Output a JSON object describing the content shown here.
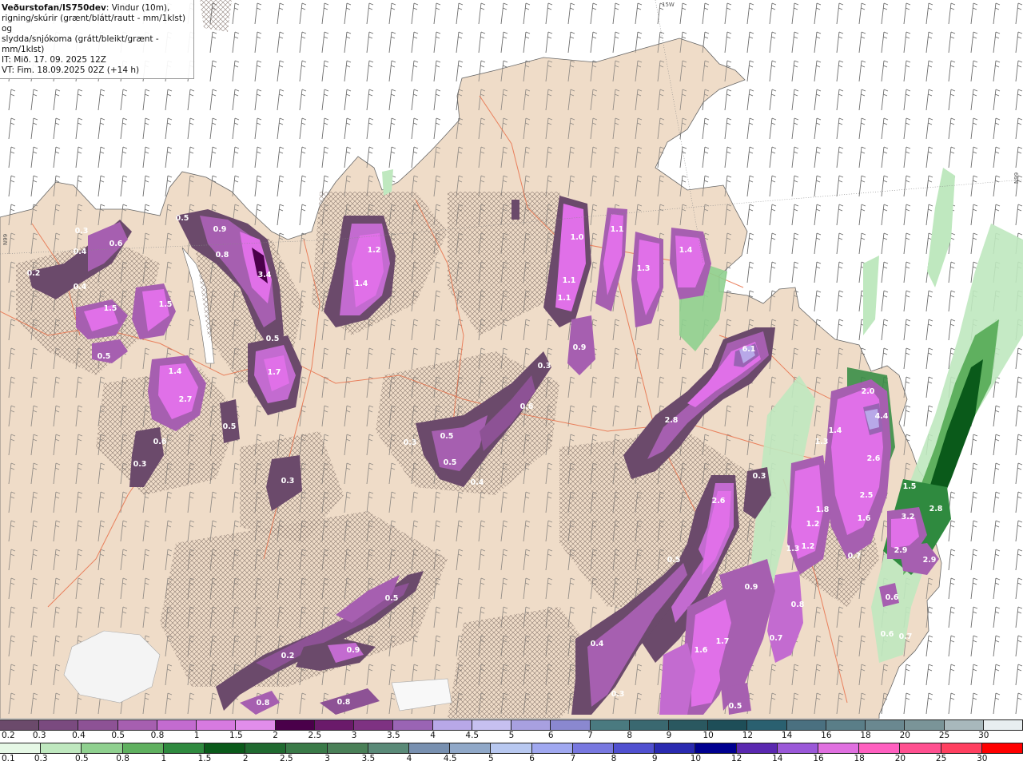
{
  "header": {
    "brand": "Veðurstofan/IS750dev",
    "line1_rest": ": Vindur (10m),",
    "line2": "rigning/skúrir (grænt/blátt/rautt - mm/1klst) og",
    "line3": "slydda/snjókoma (grátt/bleikt/grænt - mm/1klst)",
    "line4": "IT: Mið. 17. 09. 2025 12Z",
    "line5": "VT: Fim. 18.09.2025 02Z (+14 h)"
  },
  "grid_labels": {
    "top": "15W",
    "left": "N99",
    "right": "N99"
  },
  "map_values": [
    {
      "text": "0.5"
    },
    {
      "text": "0.3"
    },
    {
      "text": "0.6"
    },
    {
      "text": "0.4"
    },
    {
      "text": "0.2"
    },
    {
      "text": "0.4"
    },
    {
      "text": "0.9"
    },
    {
      "text": "0.8"
    },
    {
      "text": "3.4"
    },
    {
      "text": "1.2"
    },
    {
      "text": "1.4"
    },
    {
      "text": "1.5"
    },
    {
      "text": "1.5"
    },
    {
      "text": "0.5"
    },
    {
      "text": "1.7"
    },
    {
      "text": "0.5"
    },
    {
      "text": "1.4"
    },
    {
      "text": "2.7"
    },
    {
      "text": "0.5"
    },
    {
      "text": "0.6"
    },
    {
      "text": "0.3"
    },
    {
      "text": "0.3"
    },
    {
      "text": "1.0"
    },
    {
      "text": "1.1"
    },
    {
      "text": "1.3"
    },
    {
      "text": "1.4"
    },
    {
      "text": "1.1"
    },
    {
      "text": "1.1"
    },
    {
      "text": "0.9"
    },
    {
      "text": "0.3"
    },
    {
      "text": "0.6"
    },
    {
      "text": "0.5"
    },
    {
      "text": "0.3"
    },
    {
      "text": "0.5"
    },
    {
      "text": "0.4"
    },
    {
      "text": "6.1"
    },
    {
      "text": "2.8"
    },
    {
      "text": "2.0"
    },
    {
      "text": "4.4"
    },
    {
      "text": "1.4"
    },
    {
      "text": "2.6"
    },
    {
      "text": "1.3"
    },
    {
      "text": "0.3"
    },
    {
      "text": "2.6"
    },
    {
      "text": "2.5"
    },
    {
      "text": "1.6"
    },
    {
      "text": "1.2"
    },
    {
      "text": "1.2"
    },
    {
      "text": "1.3"
    },
    {
      "text": "0.7"
    },
    {
      "text": "0.5"
    },
    {
      "text": "3.2"
    },
    {
      "text": "2.9"
    },
    {
      "text": "2.9"
    },
    {
      "text": "0.6"
    },
    {
      "text": "0.6"
    },
    {
      "text": "0.7"
    },
    {
      "text": "0.5"
    },
    {
      "text": "0.9"
    },
    {
      "text": "0.8"
    },
    {
      "text": "0.2"
    },
    {
      "text": "0.9"
    },
    {
      "text": "0.4"
    },
    {
      "text": "1.6"
    },
    {
      "text": "1.7"
    },
    {
      "text": "0.3"
    },
    {
      "text": "0.5"
    },
    {
      "text": "0.8"
    },
    {
      "text": "0.8"
    },
    {
      "text": "0.7"
    },
    {
      "text": "1.5"
    },
    {
      "text": "1.8"
    },
    {
      "text": "2.8"
    }
  ],
  "legend_snow": {
    "labels": [
      "0.2",
      "0.3",
      "0.4",
      "0.5",
      "0.8",
      "1",
      "1.5",
      "2",
      "2.5",
      "3",
      "3.5",
      "4",
      "4.5",
      "5",
      "6",
      "7",
      "8",
      "9",
      "10",
      "12",
      "14",
      "16",
      "18",
      "20",
      "25",
      "30"
    ],
    "colors": [
      "#6b4a6b",
      "#7a4a7f",
      "#8d5295",
      "#a65fb0",
      "#c36bd0",
      "#d77ae0",
      "#e18deb",
      "#4a004a",
      "#6a1a6a",
      "#7e3282",
      "#9a64b4",
      "#b8a8e8",
      "#c6c0f0",
      "#a8a0e0",
      "#8a88d0",
      "#4a7a80",
      "#3a6870",
      "#2a5860",
      "#1e4e58",
      "#2a6070",
      "#4a7080",
      "#5a7e88",
      "#6a8890",
      "#7a9498",
      "#a8b8bc",
      "#e8eef0"
    ]
  },
  "legend_rain": {
    "labels": [
      "0.1",
      "0.3",
      "0.5",
      "0.8",
      "1",
      "1.5",
      "2",
      "2.5",
      "3",
      "3.5",
      "4",
      "4.5",
      "5",
      "6",
      "7",
      "8",
      "9",
      "10",
      "12",
      "14",
      "16",
      "18",
      "20",
      "25",
      "30"
    ],
    "colors": [
      "#e6f8e6",
      "#bfe8bf",
      "#8fd08f",
      "#5fb05f",
      "#2f8a3f",
      "#0a5a1a",
      "#206a30",
      "#3a7a48",
      "#4a8058",
      "#5a8a78",
      "#7890b0",
      "#90a8c8",
      "#b8c8f0",
      "#a0a8f0",
      "#7878e0",
      "#5050d0",
      "#2a2ab0",
      "#000090",
      "#5a28b0",
      "#9a58d8",
      "#e070e0",
      "#ff60c0",
      "#ff5090",
      "#ff4060",
      "#ff0000"
    ]
  },
  "colors": {
    "land": "#efdcc8",
    "sea": "#ffffff",
    "roads": "#e8704a",
    "coast": "#666666",
    "snow_low": "#6b4a6b",
    "snow_mid": "#a65fb0",
    "snow_high": "#e070e8",
    "rain_low": "#bfe8bf",
    "rain_mid": "#5fb05f",
    "rain_high": "#0a5a1a"
  }
}
